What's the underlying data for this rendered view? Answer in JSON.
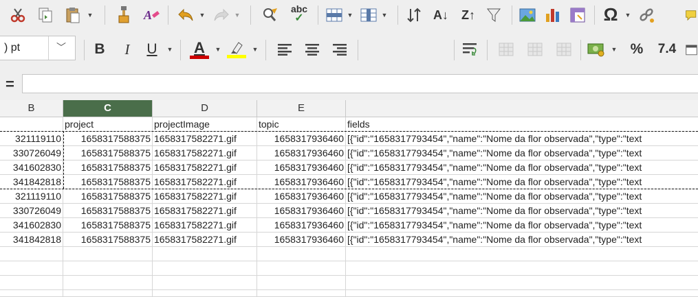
{
  "toolbar1": {
    "icons": [
      "cut-icon",
      "copy-icon",
      "paste-icon",
      "clone-formatting-icon",
      "clear-formatting-icon",
      "undo-icon",
      "redo-icon",
      "find-replace-icon",
      "spellcheck-icon",
      "row-icon",
      "column-icon",
      "sort-ascending-descending-icon",
      "sort-ascending-icon",
      "sort-descending-icon",
      "autofilter-icon",
      "insert-image-icon",
      "insert-chart-icon",
      "pivot-table-icon",
      "special-character-icon",
      "hyperlink-icon",
      "comment-icon"
    ],
    "spellcheck_label": "abc",
    "sort_asc_label": "A",
    "sort_desc_label": "Z",
    "omega_label": "Ω"
  },
  "toolbar2": {
    "font_size_value": ") pt",
    "bold_label": "B",
    "italic_label": "I",
    "underline_label": "U",
    "font_color_label": "A",
    "font_color": "#cc0000",
    "highlight_color": "#ffff00",
    "percent_label": "%",
    "number_label": "7.4"
  },
  "formula": {
    "eq_label": "=",
    "value": ""
  },
  "columns": [
    {
      "label": "B",
      "selected": false
    },
    {
      "label": "C",
      "selected": true
    },
    {
      "label": "D",
      "selected": false
    },
    {
      "label": "E",
      "selected": false
    },
    {
      "label": "",
      "selected": false
    }
  ],
  "header_row": {
    "b": "",
    "c": "project",
    "d": "projectImage",
    "e": "topic",
    "f": "fields"
  },
  "rows": [
    {
      "b": "321119110",
      "c": "1658317588375",
      "d": "1658317582271.gif",
      "e": "1658317936460",
      "f": "[{\"id\":\"1658317793454\",\"name\":\"Nome da flor observada\",\"type\":\"text"
    },
    {
      "b": "330726049",
      "c": "1658317588375",
      "d": "1658317582271.gif",
      "e": "1658317936460",
      "f": "[{\"id\":\"1658317793454\",\"name\":\"Nome da flor observada\",\"type\":\"text"
    },
    {
      "b": "341602830",
      "c": "1658317588375",
      "d": "1658317582271.gif",
      "e": "1658317936460",
      "f": "[{\"id\":\"1658317793454\",\"name\":\"Nome da flor observada\",\"type\":\"text"
    },
    {
      "b": "341842818",
      "c": "1658317588375",
      "d": "1658317582271.gif",
      "e": "1658317936460",
      "f": "[{\"id\":\"1658317793454\",\"name\":\"Nome da flor observada\",\"type\":\"text"
    },
    {
      "b": "321119110",
      "c": "1658317588375",
      "d": "1658317582271.gif",
      "e": "1658317936460",
      "f": "[{\"id\":\"1658317793454\",\"name\":\"Nome da flor observada\",\"type\":\"text"
    },
    {
      "b": "330726049",
      "c": "1658317588375",
      "d": "1658317582271.gif",
      "e": "1658317936460",
      "f": "[{\"id\":\"1658317793454\",\"name\":\"Nome da flor observada\",\"type\":\"text"
    },
    {
      "b": "341602830",
      "c": "1658317588375",
      "d": "1658317582271.gif",
      "e": "1658317936460",
      "f": "[{\"id\":\"1658317793454\",\"name\":\"Nome da flor observada\",\"type\":\"text"
    },
    {
      "b": "341842818",
      "c": "1658317588375",
      "d": "1658317582271.gif",
      "e": "1658317936460",
      "f": "[{\"id\":\"1658317793454\",\"name\":\"Nome da flor observada\",\"type\":\"text"
    }
  ]
}
